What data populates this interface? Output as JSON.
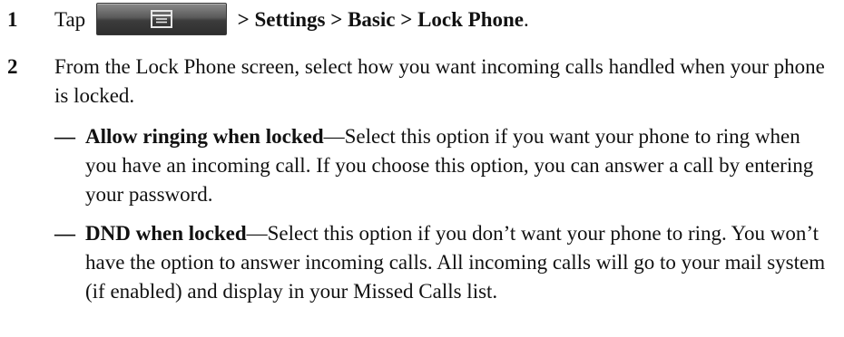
{
  "steps": [
    {
      "number": "1",
      "prefix": "Tap",
      "button_icon": "menu-icon",
      "path": "> Settings > Basic > Lock Phone",
      "suffix": "."
    },
    {
      "number": "2",
      "text": "From the Lock Phone screen, select how you want incoming calls handled when your phone is locked."
    }
  ],
  "options": [
    {
      "bullet": "—",
      "title": "Allow ringing when locked",
      "text": "—Select this option if you want your phone to ring when you have an incoming call. If you choose this option, you can answer a call by entering your password."
    },
    {
      "bullet": "—",
      "title": "DND when locked",
      "text": "—Select this option if you don’t want your phone to ring. You won’t have the option to answer incoming calls. All incoming calls will go to your mail system (if enabled) and display in your Missed Calls list."
    }
  ]
}
